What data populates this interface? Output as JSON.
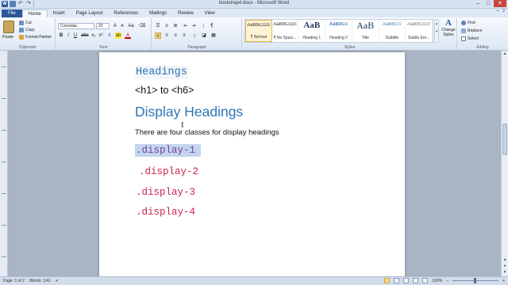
{
  "window": {
    "title": "bootstrap4.docx - Microsoft Word",
    "controls": {
      "minimize": "–",
      "maximize": "□",
      "close": "✕"
    }
  },
  "quick_access": {
    "app_icon": "W",
    "undo": "↶",
    "redo": "↷"
  },
  "tabs": [
    "File",
    "Home",
    "Insert",
    "Page Layout",
    "References",
    "Mailings",
    "Review",
    "View"
  ],
  "active_tab": "Home",
  "ribbon": {
    "clipboard": {
      "paste": "Paste",
      "cut": "Cut",
      "copy": "Copy",
      "format_painter": "Format Painter",
      "label": "Clipboard"
    },
    "font": {
      "name": "Consolas",
      "size": "22",
      "label": "Font"
    },
    "paragraph": {
      "label": "Paragraph"
    },
    "styles": {
      "items": [
        {
          "sample": "AaBbCcDc",
          "name": "¶ Normal"
        },
        {
          "sample": "AaBbCcDc",
          "name": "¶ No Spaci..."
        },
        {
          "sample": "AaB",
          "name": "Heading 1"
        },
        {
          "sample": "AaBbCc",
          "name": "Heading 2"
        },
        {
          "sample": "AaB",
          "name": "Title"
        },
        {
          "sample": "AaBbCcI",
          "name": "Subtitle"
        },
        {
          "sample": "AaBbCcDc",
          "name": "Subtle Em..."
        }
      ],
      "change_styles": "Change Styles",
      "label": "Styles"
    },
    "editing": {
      "find": "Find",
      "replace": "Replace",
      "select": "Select",
      "label": "Editing"
    }
  },
  "document": {
    "heading_small": "Headings",
    "heading_range": "<h1> to <h6>",
    "display_heading": "Display Headings",
    "body_text": "There are four classes for display headings",
    "classes": [
      ".display-1",
      ".display-2",
      ".display-3",
      ".display-4"
    ]
  },
  "status": {
    "page": "Page: 1 of 2",
    "words": "Words: 1/41",
    "zoom": "100%"
  },
  "colors": {
    "accent": "#2b579a",
    "heading": "#2e74b5",
    "code": "#c7254e",
    "selection": "#c2d6ef"
  }
}
